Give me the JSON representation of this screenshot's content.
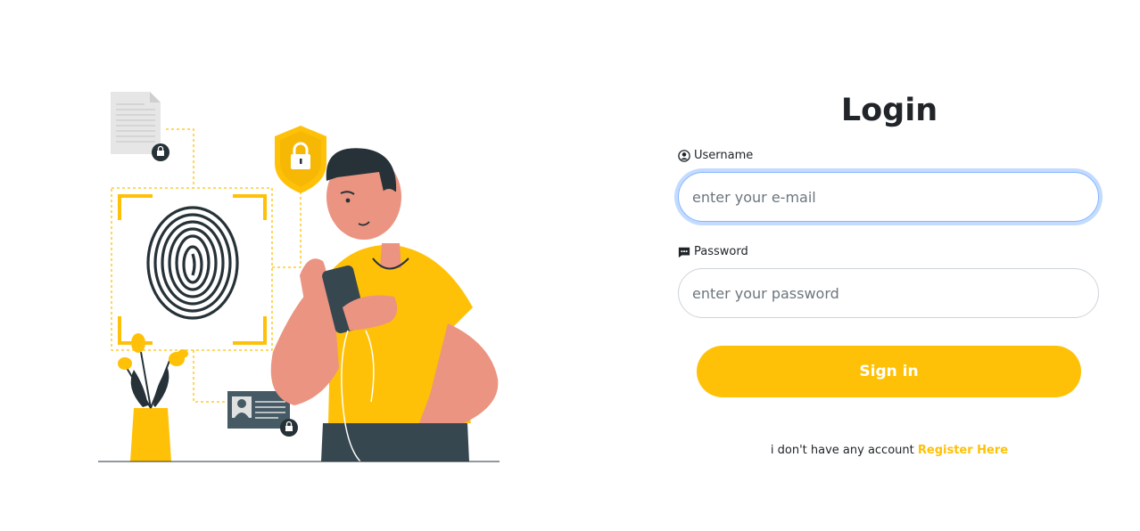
{
  "login": {
    "title": "Login",
    "username_label": "Username",
    "username_placeholder": "enter your e-mail",
    "password_label": "Password",
    "password_placeholder": "enter your password",
    "signin_label": "Sign in",
    "register_prompt": "i don't have any account",
    "register_link": "Register Here"
  },
  "colors": {
    "accent": "#ffc107",
    "text": "#212529",
    "focus_border": "#86b7fe",
    "illustration_dark": "#37474f",
    "illustration_skin": "#eb9481"
  },
  "icons": {
    "username": "user-circle-icon",
    "password": "chat-dots-icon"
  }
}
